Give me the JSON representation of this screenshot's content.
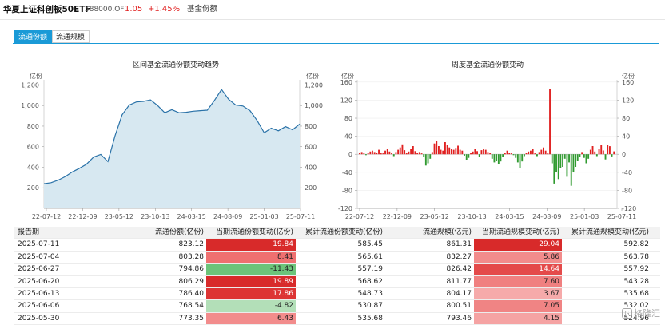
{
  "header": {
    "fund_name": "华夏上证科创板50ETF",
    "fund_code": "588000.OF",
    "price": "1.05",
    "change_pct": "+1.45%",
    "tab_label": "基金份额"
  },
  "tabs": [
    {
      "label": "流通份额",
      "active": true
    },
    {
      "label": "流通规模",
      "active": false
    }
  ],
  "colors": {
    "accent": "#1a9ad7",
    "up": "#e02020",
    "down": "#2f9a2f",
    "area_fill": "#d7e8f1",
    "area_line": "#2a72a8"
  },
  "chart_data": [
    {
      "type": "area",
      "title": "区间基金流通份额变动趋势",
      "ylabel_left": "亿份",
      "ylabel_right": "亿份",
      "yticks": [
        200,
        400,
        600,
        800,
        1000,
        1200
      ],
      "ylim": [
        0,
        1250
      ],
      "xtick_labels": [
        "22-07-12",
        "22-12-09",
        "23-05-12",
        "23-10-13",
        "24-03-15",
        "24-08-09",
        "25-01-03",
        "25-07-11"
      ],
      "x": [
        "22-07-12",
        "22-08-12",
        "22-09-09",
        "22-10-14",
        "22-11-11",
        "22-12-09",
        "23-01-13",
        "23-02-10",
        "23-03-10",
        "23-04-14",
        "23-05-12",
        "23-06-09",
        "23-07-14",
        "23-08-11",
        "23-09-08",
        "23-10-13",
        "23-11-10",
        "23-12-08",
        "24-01-12",
        "24-02-09",
        "24-03-15",
        "24-04-12",
        "24-05-10",
        "24-06-14",
        "24-07-12",
        "24-08-09",
        "24-09-06",
        "24-10-11",
        "24-11-08",
        "24-12-06",
        "25-01-03",
        "25-02-07",
        "25-03-07",
        "25-04-11",
        "25-05-09",
        "25-06-06",
        "25-07-11"
      ],
      "values": [
        240,
        250,
        275,
        310,
        355,
        390,
        430,
        500,
        525,
        455,
        705,
        910,
        1005,
        1035,
        1040,
        1055,
        1000,
        930,
        960,
        930,
        935,
        945,
        950,
        955,
        1050,
        1155,
        1060,
        1005,
        995,
        950,
        855,
        735,
        780,
        755,
        795,
        765,
        820
      ]
    },
    {
      "type": "bar",
      "title": "周度基金流通份额变动",
      "ylabel_left": "亿份",
      "ylabel_right": "亿份",
      "yticks": [
        -120,
        -80,
        -40,
        0,
        40,
        80,
        120,
        160
      ],
      "ylim": [
        -120,
        165
      ],
      "xtick_labels": [
        "22-07-12",
        "22-12-09",
        "23-05-12",
        "23-10-13",
        "24-03-15",
        "24-08-09",
        "25-01-03",
        "25-07-11"
      ],
      "values": [
        3,
        5,
        2,
        -2,
        4,
        6,
        8,
        5,
        3,
        10,
        4,
        2,
        8,
        12,
        6,
        3,
        -4,
        5,
        10,
        15,
        22,
        9,
        4,
        6,
        12,
        18,
        7,
        3,
        5,
        2,
        -5,
        -25,
        -20,
        -10,
        5,
        24,
        30,
        18,
        10,
        8,
        27,
        20,
        15,
        12,
        10,
        14,
        19,
        10,
        8,
        -3,
        -12,
        -8,
        4,
        6,
        12,
        7,
        -5,
        9,
        12,
        10,
        5,
        3,
        -10,
        -18,
        -14,
        -22,
        -16,
        -5,
        4,
        8,
        3,
        2,
        -2,
        -8,
        -18,
        -30,
        -16,
        -4,
        3,
        6,
        8,
        12,
        2,
        -4,
        5,
        10,
        15,
        8,
        4,
        145,
        -20,
        -65,
        -40,
        -55,
        -30,
        -28,
        -10,
        -50,
        -18,
        -70,
        -40,
        -28,
        -15,
        -5,
        5,
        -8,
        -20,
        -10,
        10,
        18,
        6,
        -4,
        12,
        19.84,
        8.41,
        -11.43,
        19.89,
        17.86,
        -4.82,
        6.43
      ]
    }
  ],
  "table": {
    "columns": [
      "报告期",
      "流通份额(亿份)",
      "当期流通份额变动(亿份)",
      "累计流通份额变动(亿份)",
      "流通规模(亿元)",
      "当期流通规模变动(亿元)",
      "累计流通规模变动(亿元)"
    ],
    "rows": [
      {
        "date": "2025-07-11",
        "shares": "823.12",
        "chg": "19.84",
        "cum": "585.45",
        "scale": "861.31",
        "scale_chg": "29.04",
        "scale_cum": "592.82",
        "chg_bg": "#d82a2a",
        "scale_bg": "#d82a2a"
      },
      {
        "date": "2025-07-04",
        "shares": "803.28",
        "chg": "8.41",
        "cum": "565.61",
        "scale": "832.27",
        "scale_chg": "5.86",
        "scale_cum": "563.78",
        "chg_bg": "#ef7070",
        "scale_bg": "#f28c8c"
      },
      {
        "date": "2025-06-27",
        "shares": "794.86",
        "chg": "-11.43",
        "cum": "557.19",
        "scale": "826.42",
        "scale_chg": "14.64",
        "scale_cum": "557.92",
        "chg_bg": "#6cc47a",
        "scale_bg": "#e44a4a"
      },
      {
        "date": "2025-06-20",
        "shares": "806.29",
        "chg": "19.89",
        "cum": "568.62",
        "scale": "811.77",
        "scale_chg": "7.60",
        "scale_cum": "543.28",
        "chg_bg": "#d82a2a",
        "scale_bg": "#f08080"
      },
      {
        "date": "2025-06-13",
        "shares": "786.40",
        "chg": "17.86",
        "cum": "548.73",
        "scale": "804.17",
        "scale_chg": "3.67",
        "scale_cum": "535.68",
        "chg_bg": "#dd3434",
        "scale_bg": "#f6aaaa"
      },
      {
        "date": "2025-06-06",
        "shares": "768.54",
        "chg": "-4.82",
        "cum": "530.87",
        "scale": "800.51",
        "scale_chg": "7.05",
        "scale_cum": "532.02",
        "chg_bg": "#b3dfb8",
        "scale_bg": "#f08484"
      },
      {
        "date": "2025-05-30",
        "shares": "773.35",
        "chg": "6.43",
        "cum": "535.68",
        "scale": "793.46",
        "scale_chg": "4.15",
        "scale_cum": "524.96",
        "chg_bg": "#f28c8c",
        "scale_bg": "#f5a3a3"
      }
    ]
  },
  "watermark": "格隆汇"
}
